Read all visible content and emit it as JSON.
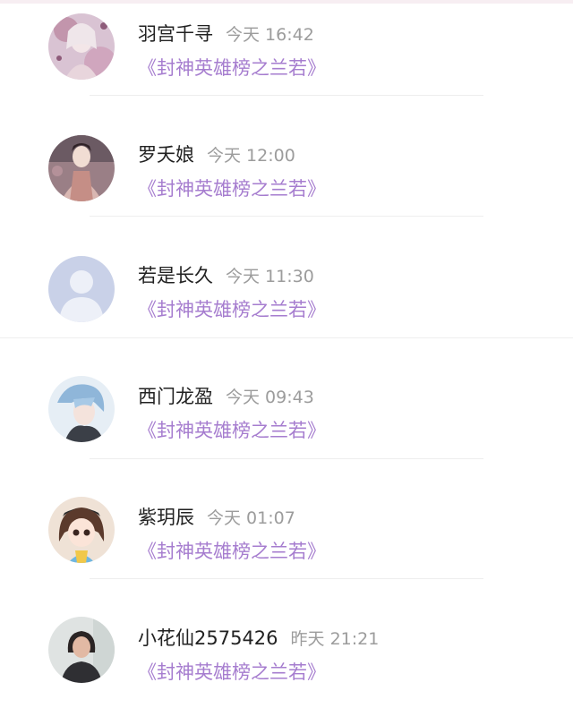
{
  "entries": [
    {
      "name": "羽宫千寻",
      "time": "今天 16:42",
      "work": "《封神英雄榜之兰若》",
      "avatar_icon": "avatar-costume-pink-icon"
    },
    {
      "name": "罗夭娘",
      "time": "今天 12:00",
      "work": "《封神英雄榜之兰若》",
      "avatar_icon": "avatar-hanfu-lady-icon"
    },
    {
      "name": "若是长久",
      "time": "今天 11:30",
      "work": "《封神英雄榜之兰若》",
      "avatar_icon": "avatar-default-placeholder-icon"
    },
    {
      "name": "西门龙盈",
      "time": "今天 09:43",
      "work": "《封神英雄榜之兰若》",
      "avatar_icon": "avatar-blue-hair-boy-icon"
    },
    {
      "name": "紫玥辰",
      "time": "今天 01:07",
      "work": "《封神英雄榜之兰若》",
      "avatar_icon": "avatar-cartoon-girl-icon"
    },
    {
      "name": "小花仙2575426",
      "time": "昨天 21:21",
      "work": "《封神英雄榜之兰若》",
      "avatar_icon": "avatar-photo-woman-icon"
    }
  ],
  "colors": {
    "link": "#a67dcf",
    "name": "#222222",
    "time": "#9c9c9c",
    "divider": "#eeeeee"
  }
}
